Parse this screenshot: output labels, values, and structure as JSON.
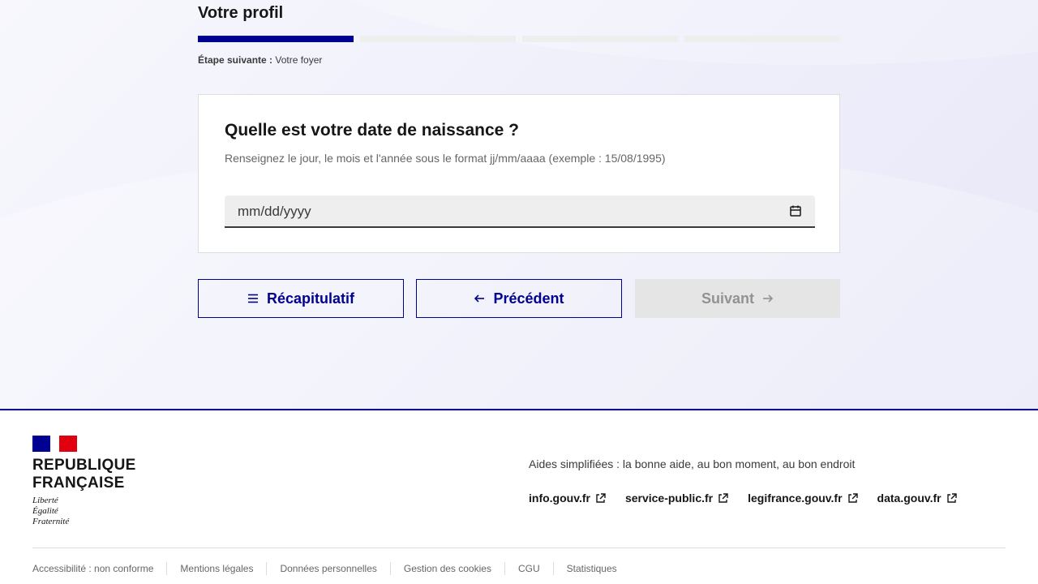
{
  "step": {
    "title": "Votre profil",
    "segments": [
      true,
      false,
      false,
      false
    ],
    "progress": 0.25,
    "next_label": "Étape suivante :",
    "next_value": " Votre foyer"
  },
  "question": {
    "title": "Quelle est votre date de naissance ?",
    "hint": "Renseignez le jour, le mois et l'année sous le format jj/mm/aaaa (exemple : 15/08/1995)",
    "date_placeholder": "mm/dd/yyyy"
  },
  "buttons": {
    "recap": "Récapitulatif",
    "previous": "Précédent",
    "next": "Suivant"
  },
  "colors": {
    "primary": "#000091",
    "red": "#e1000f"
  },
  "footer": {
    "brand_line1": "REPUBLIQUE",
    "brand_line2": "FRANÇAISE",
    "motto1": "Liberté",
    "motto2": "Égalité",
    "motto3": "Fraternité",
    "tagline": "Aides simplifiées : la bonne aide, au bon moment, au bon endroit",
    "external_links": [
      "info.gouv.fr",
      "service-public.fr",
      "legifrance.gouv.fr",
      "data.gouv.fr"
    ],
    "bottom_links": [
      "Accessibilité : non conforme",
      "Mentions légales",
      "Données personnelles",
      "Gestion des cookies",
      "CGU",
      "Statistiques"
    ]
  }
}
